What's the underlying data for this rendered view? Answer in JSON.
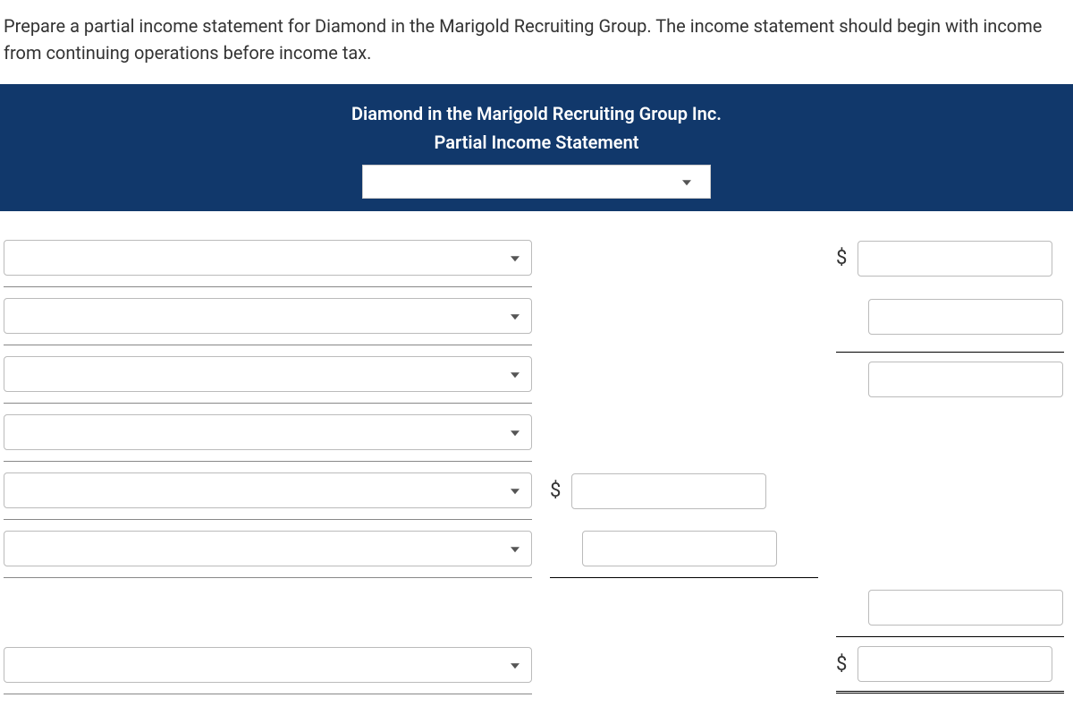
{
  "instructions": "Prepare a partial income statement for Diamond in the Marigold Recruiting Group. The income statement should begin with income from continuing operations before income tax.",
  "header": {
    "company": "Diamond in the Marigold Recruiting Group Inc.",
    "title": "Partial Income Statement",
    "period_dropdown_value": ""
  },
  "currency_symbol": "$",
  "rows": [
    {
      "label_value": "",
      "col2_dollar": false,
      "col2_value": null,
      "col3_dollar": true,
      "col3_value": ""
    },
    {
      "label_value": "",
      "col2_dollar": false,
      "col2_value": null,
      "col3_dollar": false,
      "col3_value": ""
    },
    {
      "label_value": "",
      "col2_dollar": false,
      "col2_value": null,
      "col3_dollar": false,
      "col3_value": ""
    },
    {
      "label_value": "",
      "col2_dollar": false,
      "col2_value": null,
      "col3_dollar": false,
      "col3_value": null
    },
    {
      "label_value": "",
      "col2_dollar": true,
      "col2_value": "",
      "col3_dollar": false,
      "col3_value": null
    },
    {
      "label_value": "",
      "col2_dollar": false,
      "col2_value": "",
      "col3_dollar": false,
      "col3_value": null
    },
    {
      "label_value": null,
      "col2_dollar": false,
      "col2_value": null,
      "col3_dollar": false,
      "col3_value": ""
    },
    {
      "label_value": "",
      "col2_dollar": false,
      "col2_value": null,
      "col3_dollar": true,
      "col3_value": ""
    }
  ]
}
